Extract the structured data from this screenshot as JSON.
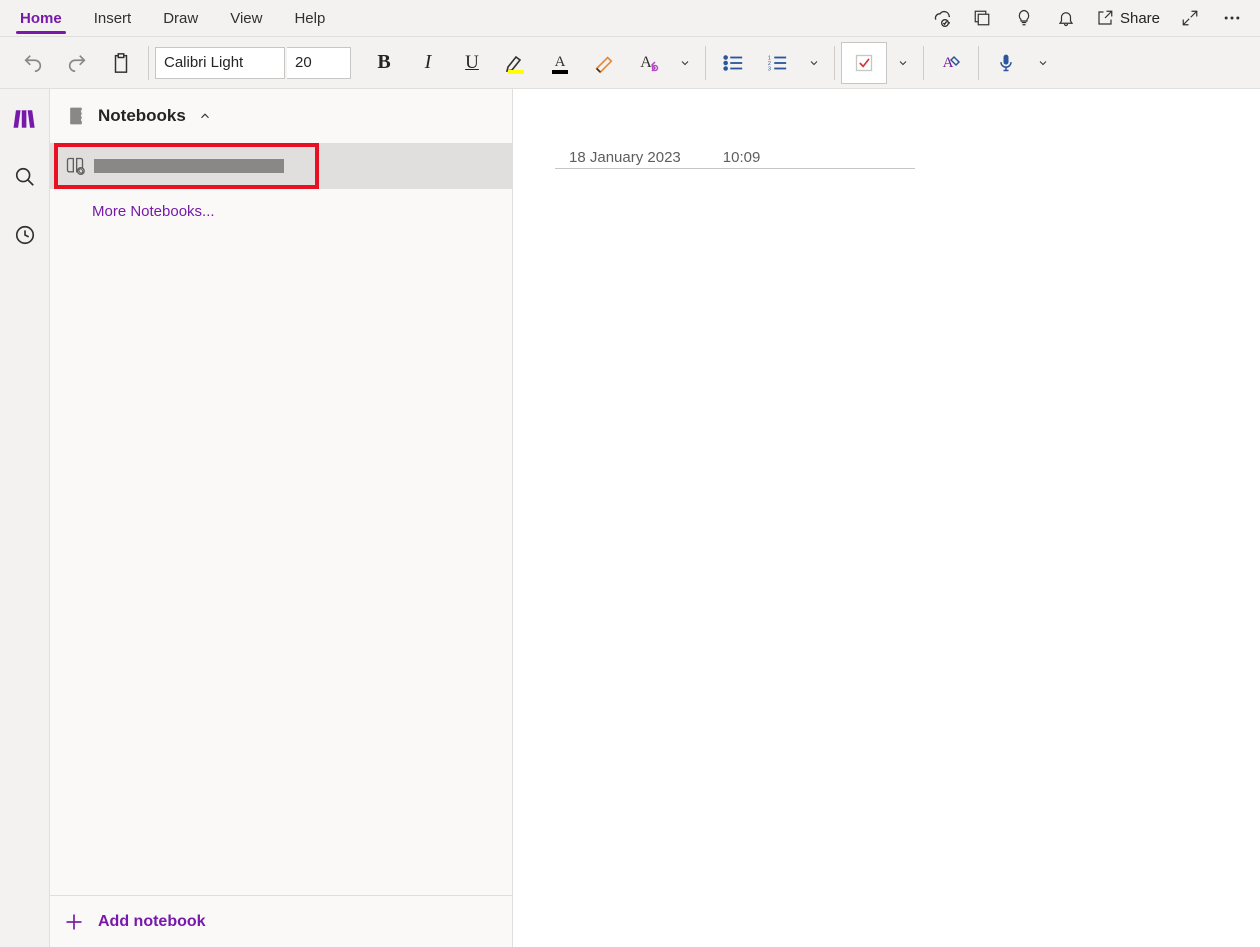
{
  "menu": {
    "tabs": [
      "Home",
      "Insert",
      "Draw",
      "View",
      "Help"
    ],
    "active_tab": 0,
    "share_label": "Share"
  },
  "ribbon": {
    "font_name": "Calibri Light",
    "font_size": "20",
    "accent_color": "#7719AA"
  },
  "sidebar": {
    "header_label": "Notebooks",
    "notebook_items": [
      {
        "name_redacted": true
      }
    ],
    "more_link": "More Notebooks...",
    "add_label": "Add notebook"
  },
  "page": {
    "date": "18 January 2023",
    "time": "10:09"
  }
}
